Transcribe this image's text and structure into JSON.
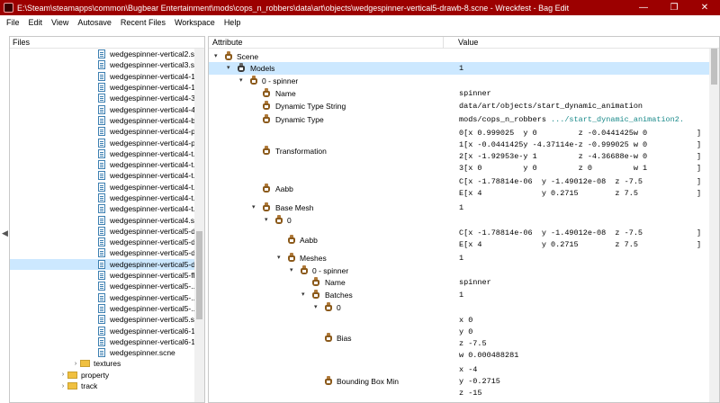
{
  "window": {
    "title": "E:\\Steam\\steamapps\\common\\Bugbear Entertainment\\mods\\cops_n_robbers\\data\\art\\objects\\wedgespinner-vertical5-drawb-8.scne - Wreckfest - Bag Edit",
    "minimize": "—",
    "maximize": "❐",
    "close": "✕"
  },
  "menu": [
    "File",
    "Edit",
    "View",
    "Autosave",
    "Recent Files",
    "Workspace",
    "Help"
  ],
  "files_panel": {
    "header": "Files",
    "files": [
      "wedgespinner-vertical2.s...",
      "wedgespinner-vertical3.s...",
      "wedgespinner-vertical4-1...",
      "wedgespinner-vertical4-1...",
      "wedgespinner-vertical4-3...",
      "wedgespinner-vertical4-4...",
      "wedgespinner-vertical4-b...",
      "wedgespinner-vertical4-p...",
      "wedgespinner-vertical4-p...",
      "wedgespinner-vertical4-t...",
      "wedgespinner-vertical4-t...",
      "wedgespinner-vertical4-t...",
      "wedgespinner-vertical4-t...",
      "wedgespinner-vertical4-t...",
      "wedgespinner-vertical4-t...",
      "wedgespinner-vertical4.s...",
      "wedgespinner-vertical5-d...",
      "wedgespinner-vertical5-d...",
      "wedgespinner-vertical5-d...",
      "wedgespinner-vertical5-d...",
      "wedgespinner-vertical5-fl...",
      "wedgespinner-vertical5-...",
      "wedgespinner-vertical5-...",
      "wedgespinner-vertical5-...",
      "wedgespinner-vertical5.s...",
      "wedgespinner-vertical6-1...",
      "wedgespinner-vertical6-1...",
      "wedgespinner.scne"
    ],
    "selected_index": 19,
    "folders": [
      "textures",
      "property",
      "track"
    ]
  },
  "attr_panel": {
    "header_attribute": "Attribute",
    "header_value": "Value",
    "rows": {
      "scene": "Scene",
      "models": "Models",
      "models_val": "1",
      "spinner0": "0 - spinner",
      "name": "Name",
      "name_val": "spinner",
      "dts": "Dynamic Type String",
      "dts_val": "data/art/objects/start_dynamic_animation",
      "dt": "Dynamic Type",
      "dt_val_a": "mods/cops_n_robbers ",
      "dt_val_b": ".../start_dynamic_animation2.",
      "transformation": "Transformation",
      "t_rows": [
        "0[x 0.999025  y 0         z -0.0441425w 0",
        "1[x -0.0441425y -4.37114e-z -0.999025 w 0",
        "2[x -1.92953e-y 1         z -4.36688e-w 0",
        "3[x 0         y 0         z 0         w 1"
      ],
      "aabb": "Aabb",
      "aabb_rows": [
        "C[x -1.78814e-06  y -1.49012e-08  z -7.5",
        "E[x 4             y 0.2715        z 7.5"
      ],
      "base_mesh": "Base Mesh",
      "base_mesh_val": "1",
      "zero": "0",
      "aabb2": "Aabb",
      "aabb2_rows": [
        "C[x -1.78814e-06  y -1.49012e-08  z -7.5",
        "E[x 4             y 0.2715        z 7.5"
      ],
      "meshes": "Meshes",
      "meshes_val": "1",
      "spinner1": "0 - spinner",
      "name2": "Name",
      "name2_val": "spinner",
      "batches": "Batches",
      "batches_val": "1",
      "zero2": "0",
      "bias": "Bias",
      "bias_rows": [
        "x 0",
        "y 0",
        "z -7.5",
        "w 0.000488281"
      ],
      "bbmin": "Bounding Box Min",
      "bbmin_rows": [
        "x -4",
        "y -0.2715",
        "z -15"
      ]
    }
  }
}
